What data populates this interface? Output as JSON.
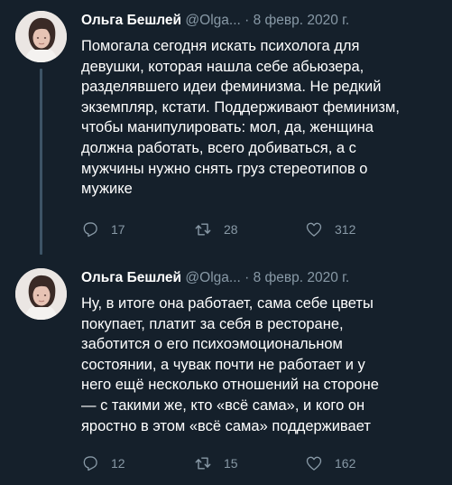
{
  "tweets": [
    {
      "author_name": "Ольга Бешлей",
      "handle": "@Olga...",
      "separator": "·",
      "date": "8 февр. 2020 г.",
      "text": "Помогала сегодня искать психолога для\nдевушки, которая нашла себе абьюзера,\nразделявшего идеи феминизма. Не редкий\nэкземпляр, кстати. Поддерживают феминизм,\nчтобы манипулировать: мол, да, женщина\nдолжна работать, всего добиваться, а с\nмужчины нужно снять груз стереотипов о\nмужике",
      "replies": "17",
      "retweets": "28",
      "likes": "312"
    },
    {
      "author_name": "Ольга Бешлей",
      "handle": "@Olga...",
      "separator": "·",
      "date": "8 февр. 2020 г.",
      "text": "Ну, в итоге она работает, сама себе цветы\nпокупает, платит за себя в ресторане,\nзаботится о его психоэмоциональном\nсостоянии, а чувак почти не работает и у\nнего ещё несколько отношений на стороне\n— с такими же, кто «всё сама», и кого он\nяростно в этом «всё сама» поддерживает",
      "replies": "12",
      "retweets": "15",
      "likes": "162"
    }
  ],
  "colors": {
    "background": "#15202b",
    "text": "#ffffff",
    "secondary": "#8899a6",
    "thread_line": "#3d5466"
  },
  "icons": [
    "reply-icon",
    "retweet-icon",
    "like-icon"
  ]
}
